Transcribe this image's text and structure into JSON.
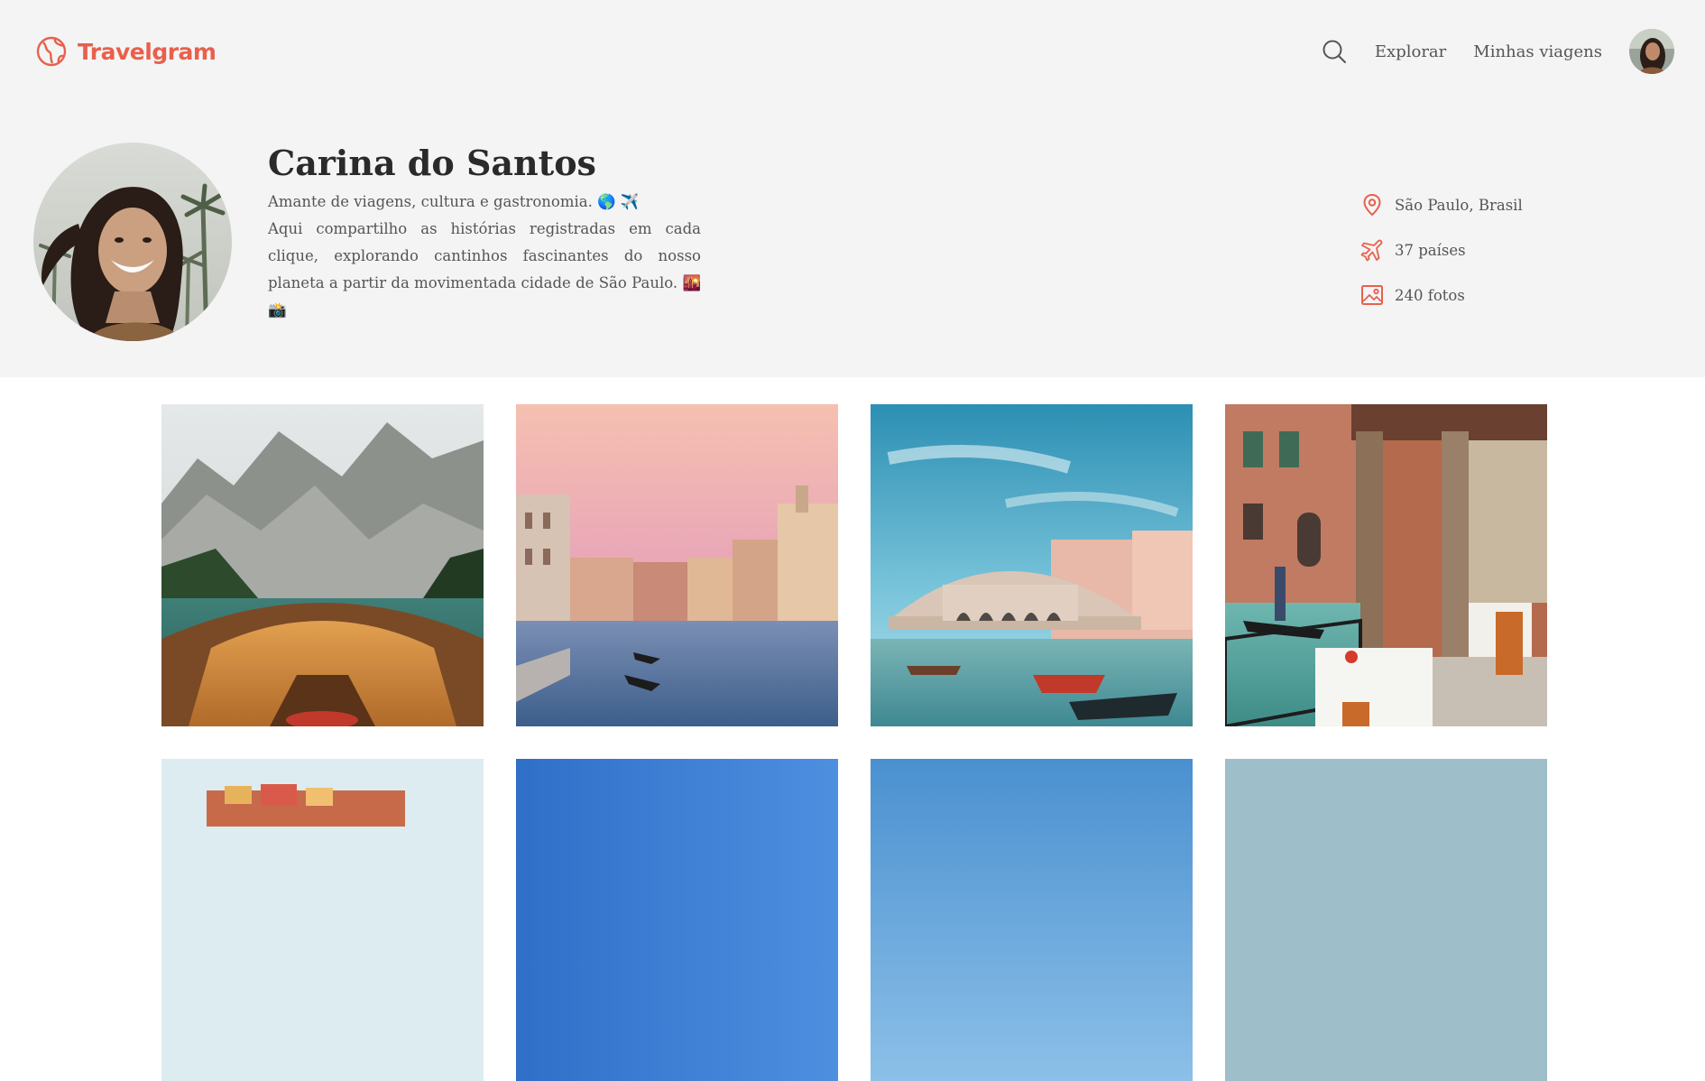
{
  "app": {
    "name": "Travelgram",
    "accent": "#e8604c"
  },
  "nav": {
    "explore_label": "Explorar",
    "my_trips_label": "Minhas viagens"
  },
  "profile": {
    "name": "Carina do Santos",
    "bio_line1": "Amante de viagens, cultura e gastronomia. 🌎 ✈️",
    "bio_line2": "Aqui compartilho as histórias registradas em cada clique, explorando cantinhos fascinantes do nosso planeta a partir da movimentada cidade de São Paulo. 🌇 📸"
  },
  "stats": {
    "location": "São Paulo, Brasil",
    "countries": "37 países",
    "photos": "240 fotos"
  },
  "photos": [
    {
      "subject": "boat on mountain lake"
    },
    {
      "subject": "venice canal at dusk"
    },
    {
      "subject": "rialto bridge venice"
    },
    {
      "subject": "venice canal-side restaurant"
    },
    {
      "subject": "coastal town"
    },
    {
      "subject": "blue sky"
    },
    {
      "subject": "blue sky"
    },
    {
      "subject": "pale sky"
    }
  ]
}
